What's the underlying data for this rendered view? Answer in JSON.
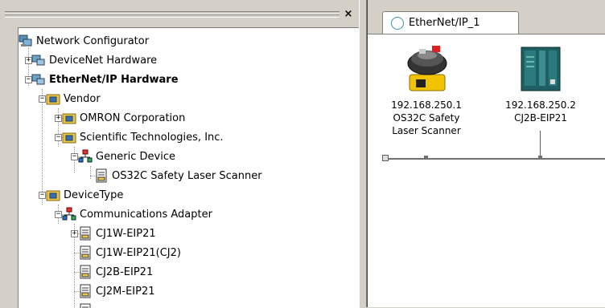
{
  "tree": {
    "items": [
      {
        "label": "Network Configurator",
        "icon": "network-configurator-icon"
      },
      {
        "label": "DeviceNet Hardware",
        "icon": "hardware-icon"
      },
      {
        "label": "EtherNet/IP Hardware",
        "icon": "hardware-icon"
      },
      {
        "label": "Vendor",
        "icon": "folder-icon"
      },
      {
        "label": "OMRON Corporation",
        "icon": "folder-icon"
      },
      {
        "label": "Scientific Technologies, Inc.",
        "icon": "folder-icon"
      },
      {
        "label": "Generic Device",
        "icon": "device-type-icon"
      },
      {
        "label": "OS32C Safety Laser Scanner",
        "icon": "device-icon"
      },
      {
        "label": "DeviceType",
        "icon": "folder-icon"
      },
      {
        "label": "Communications Adapter",
        "icon": "device-type-icon"
      },
      {
        "label": "CJ1W-EIP21",
        "icon": "device-icon"
      },
      {
        "label": "CJ1W-EIP21(CJ2)",
        "icon": "device-icon"
      },
      {
        "label": "CJ2B-EIP21",
        "icon": "device-icon"
      },
      {
        "label": "CJ2M-EIP21",
        "icon": "device-icon"
      }
    ],
    "close_label": "×"
  },
  "network_view": {
    "tab_label": "EtherNet/IP_1",
    "devices": [
      {
        "ip": "192.168.250.1",
        "name_line1": "OS32C Safety",
        "name_line2": "Laser Scanner"
      },
      {
        "ip": "192.168.250.2",
        "name_line1": "CJ2B-EIP21",
        "name_line2": ""
      }
    ]
  },
  "colors": {
    "accent": "#3a8fa8",
    "folder": "#e8c54a",
    "device_body": "#1f5f63"
  }
}
